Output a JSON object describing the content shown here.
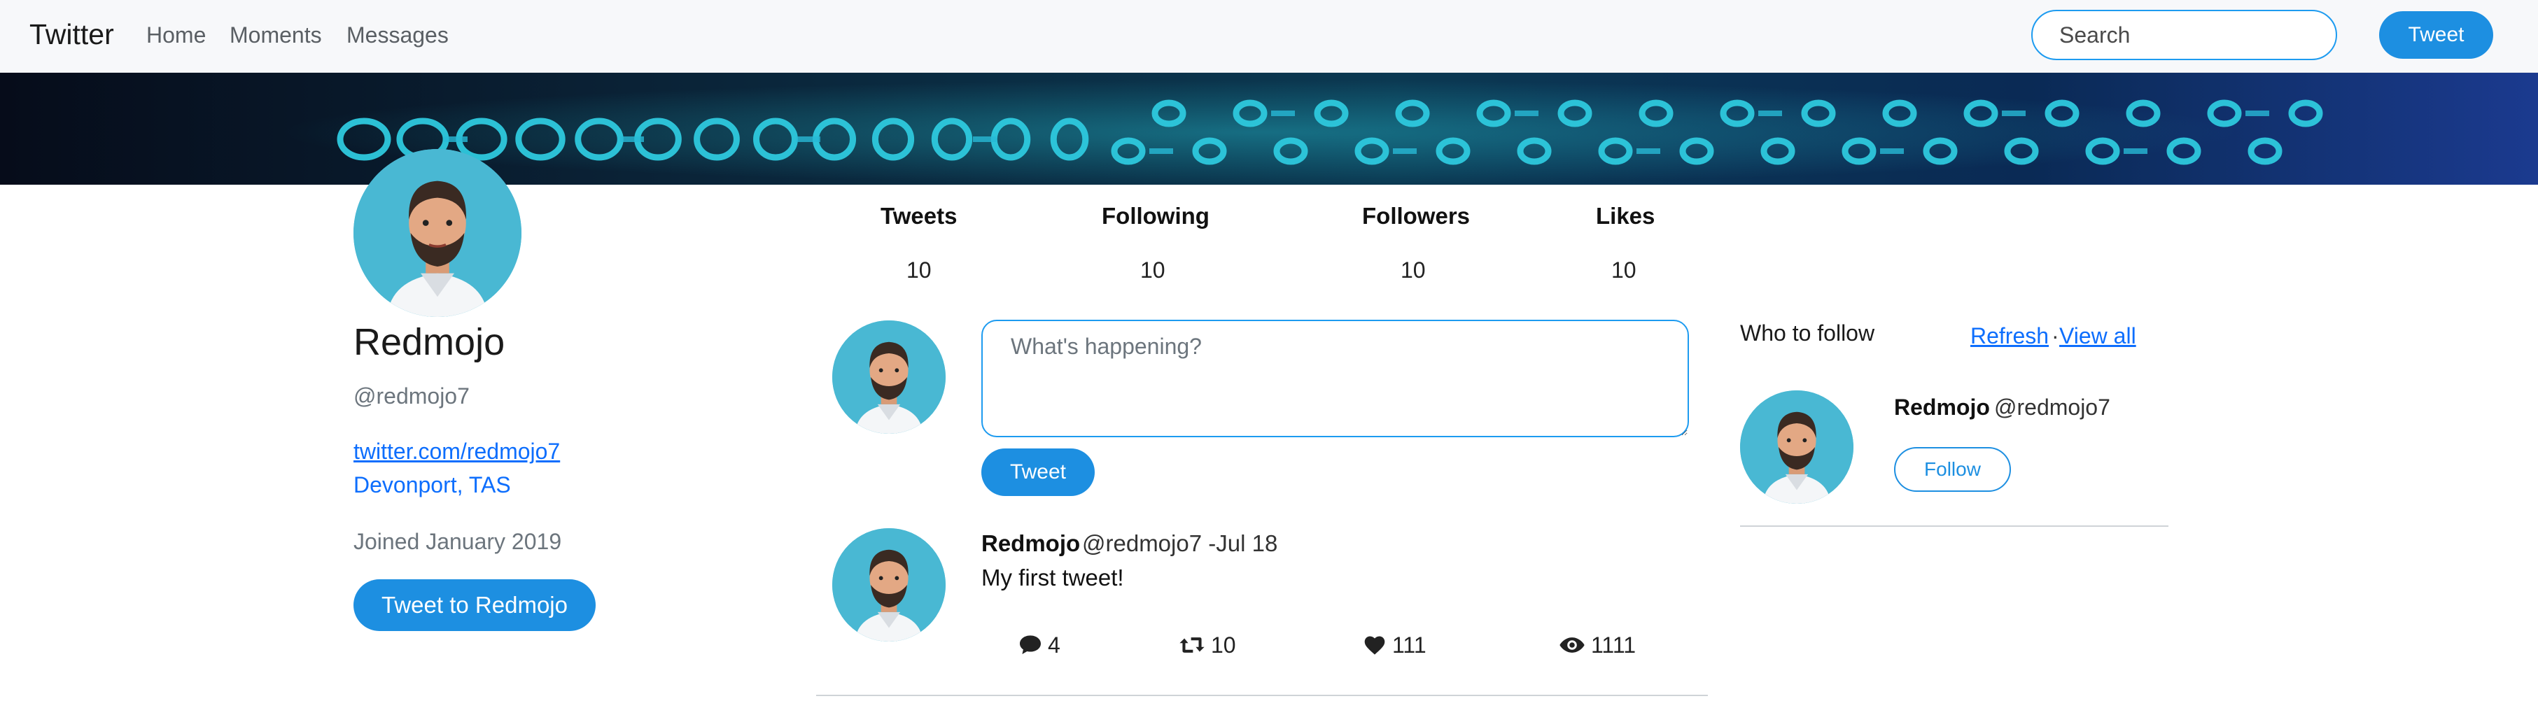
{
  "navbar": {
    "brand": "Twitter",
    "links": [
      "Home",
      "Moments",
      "Messages"
    ],
    "search_placeholder": "Search",
    "tweet_button": "Tweet"
  },
  "profile": {
    "name": "Redmojo",
    "handle": "@redmojo7",
    "link": "twitter.com/redmojo7",
    "location": "Devonport, TAS",
    "joined": "Joined January 2019",
    "tweet_to_button": "Tweet to Redmojo"
  },
  "stats": [
    {
      "label": "Tweets",
      "value": "10"
    },
    {
      "label": "Following",
      "value": "10"
    },
    {
      "label": "Followers",
      "value": "10"
    },
    {
      "label": "Likes",
      "value": "10"
    }
  ],
  "composer": {
    "placeholder": "What's happening?",
    "button": "Tweet"
  },
  "tweet": {
    "name": "Redmojo",
    "handle_date": "@redmojo7 -Jul 18",
    "text": "My first tweet!",
    "replies": "4",
    "retweets": "10",
    "likes": "111",
    "views": "1111"
  },
  "who_to_follow": {
    "title": "Who to follow",
    "refresh": "Refresh",
    "separator": "·",
    "view_all": "View all",
    "suggestion": {
      "name": "Redmojo",
      "handle": "@redmojo7",
      "follow_button": "Follow"
    }
  },
  "colors": {
    "accent": "#1d8fe1",
    "link": "#0d6efd",
    "avatar_bg": "#49b8d3"
  }
}
